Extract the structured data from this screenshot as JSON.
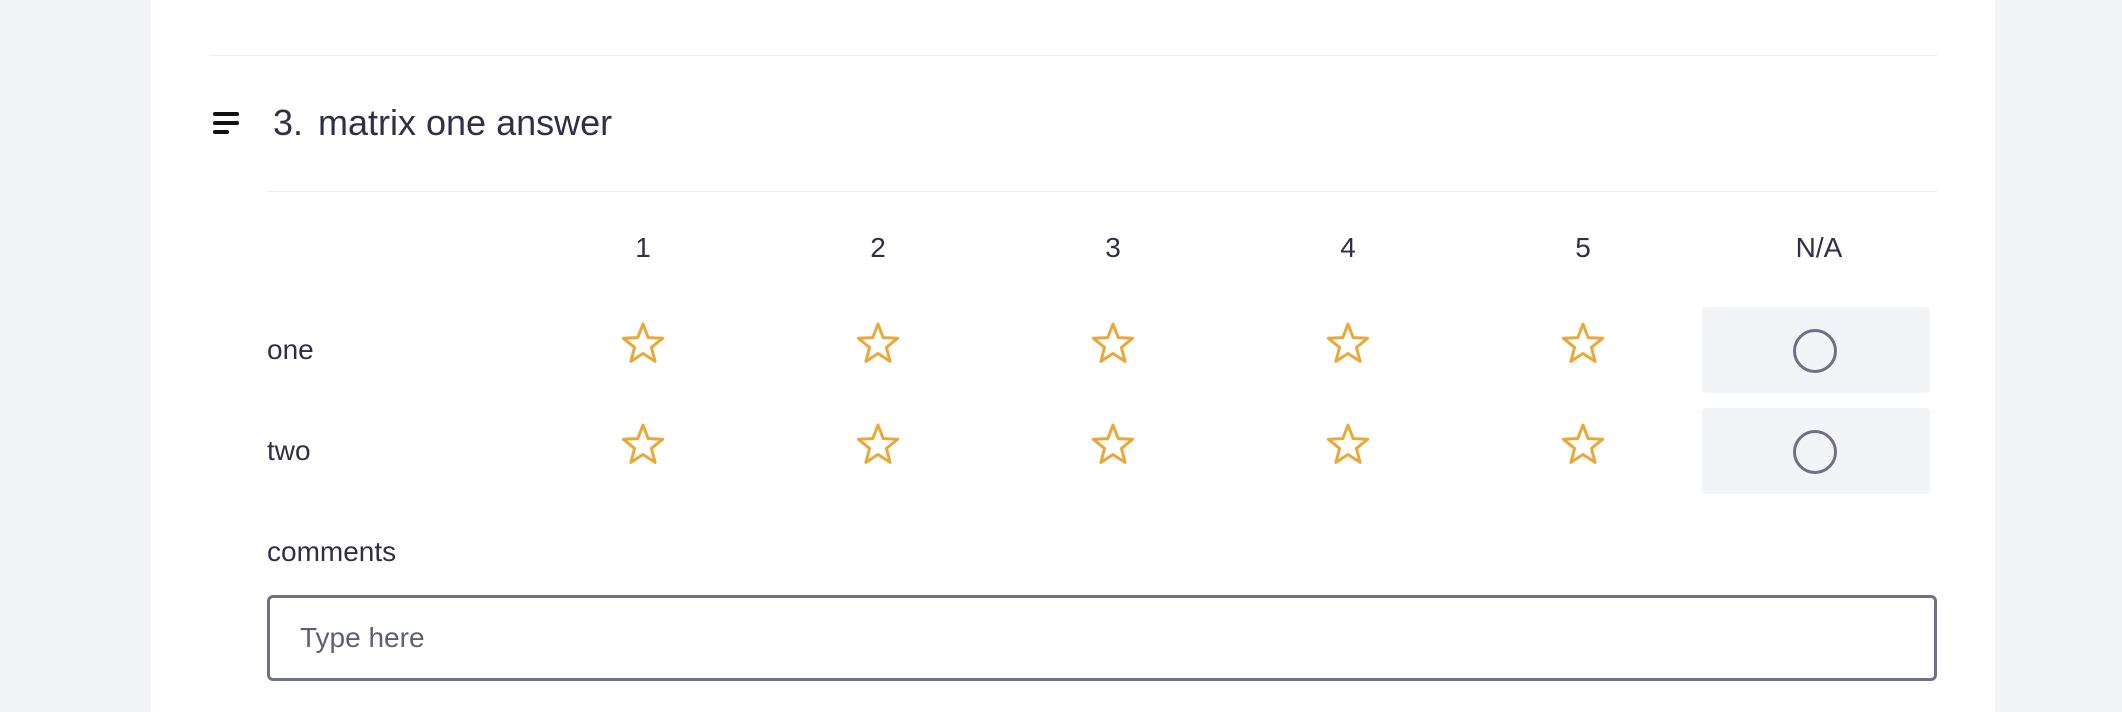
{
  "question": {
    "number": "3.",
    "title": "matrix one answer"
  },
  "matrix": {
    "columns": [
      "1",
      "2",
      "3",
      "4",
      "5",
      "N/A"
    ],
    "rows": [
      {
        "label": "one"
      },
      {
        "label": "two"
      }
    ]
  },
  "comments": {
    "label": "comments",
    "placeholder": "Type here",
    "value": ""
  },
  "icons": {
    "drag": "drag-handle-icon",
    "star": "star-outline-icon",
    "radio": "radio-empty-icon"
  },
  "colors": {
    "star": "#e8a93a",
    "text": "#2f3047",
    "border": "#6d7087",
    "cell_bg": "#f3f4f8"
  }
}
